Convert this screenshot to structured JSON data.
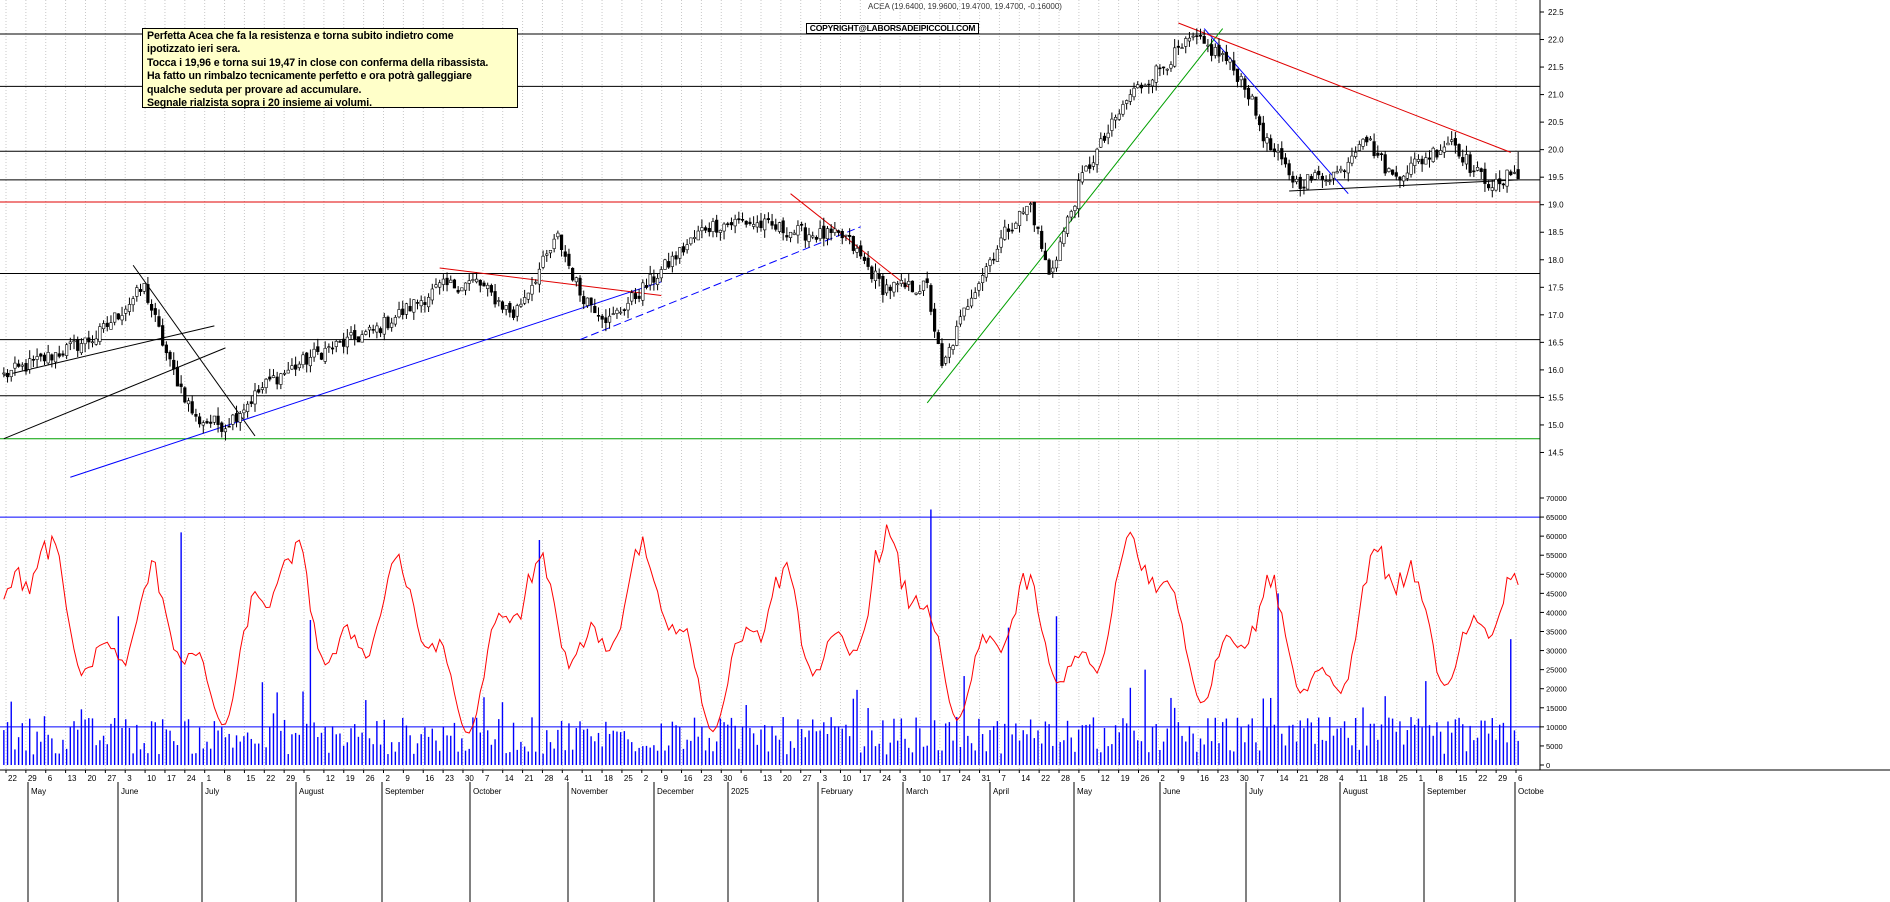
{
  "header": {
    "title": "ACEA (19.6400, 19.9600, 19.4700, 19.4700, -0.16000)",
    "copyright": "COPYRIGHT@LABORSADEIPICCOLI.COM"
  },
  "note": {
    "lines": [
      "Perfetta Acea che fa la resistenza e torna subito indietro come",
      "ipotizzato ieri sera.",
      "Tocca i 19,96 e torna sui 19,47 in close con conferma della ribassista.",
      "Ha fatto un rimbalzo tecnicamente perfetto e ora potrà galleggiare",
      "qualche seduta per provare ad accumulare.",
      "Segnale rialzista sopra i 20 insieme ai volumi."
    ]
  },
  "colors": {
    "candle": "#000000",
    "support_black": "#000000",
    "support_red": "#e00000",
    "support_green": "#00a000",
    "trend_blue": "#0000ff",
    "volume": "#0000ff",
    "oscillator": "#ff0000",
    "grid": "#c8c8c8",
    "note_bg": "#ffffc9"
  },
  "chart_data": [
    {
      "type": "candlestick",
      "title": "",
      "ylim": [
        14.0,
        22.5
      ],
      "y_ticks": [
        "14.5",
        "15.0",
        "15.5",
        "16.0",
        "16.5",
        "17.0",
        "17.5",
        "18.0",
        "18.5",
        "19.0",
        "19.5",
        "20.0",
        "20.5",
        "21.0",
        "21.5",
        "22.0",
        "22.5"
      ],
      "x_day_ticks": [
        "22",
        "29",
        "6",
        "13",
        "20",
        "27",
        "3",
        "10",
        "17",
        "24",
        "1",
        "8",
        "15",
        "22",
        "29",
        "5",
        "12",
        "19",
        "26",
        "2",
        "9",
        "16",
        "23",
        "30",
        "7",
        "14",
        "21",
        "28",
        "4",
        "11",
        "18",
        "25",
        "2",
        "9",
        "16",
        "23",
        "30",
        "6",
        "13",
        "20",
        "27",
        "3",
        "10",
        "17",
        "24",
        "3",
        "10",
        "17",
        "24",
        "31",
        "7",
        "14",
        "22",
        "28",
        "5",
        "12",
        "19",
        "26",
        "2",
        "9",
        "16",
        "23",
        "30",
        "7",
        "14",
        "21",
        "28",
        "4",
        "11",
        "18",
        "25",
        "1",
        "8",
        "15",
        "22",
        "29",
        "6"
      ],
      "x_month_labels": [
        "May",
        "June",
        "July",
        "August",
        "September",
        "October",
        "November",
        "December",
        "2025",
        "February",
        "March",
        "April",
        "May",
        "June",
        "July",
        "August",
        "September",
        "Octobe"
      ],
      "anchors": [
        {
          "bar": 0,
          "close": 15.9
        },
        {
          "bar": 25,
          "close": 16.6
        },
        {
          "bar": 38,
          "close": 17.5
        },
        {
          "bar": 45,
          "close": 16.1
        },
        {
          "bar": 52,
          "close": 15.1
        },
        {
          "bar": 60,
          "close": 15.0
        },
        {
          "bar": 72,
          "close": 15.8
        },
        {
          "bar": 85,
          "close": 16.3
        },
        {
          "bar": 100,
          "close": 16.7
        },
        {
          "bar": 118,
          "close": 17.5
        },
        {
          "bar": 128,
          "close": 17.6
        },
        {
          "bar": 138,
          "close": 17.0
        },
        {
          "bar": 150,
          "close": 18.4
        },
        {
          "bar": 156,
          "close": 17.4
        },
        {
          "bar": 164,
          "close": 16.9
        },
        {
          "bar": 175,
          "close": 17.6
        },
        {
          "bar": 190,
          "close": 18.6
        },
        {
          "bar": 200,
          "close": 18.7
        },
        {
          "bar": 215,
          "close": 18.5
        },
        {
          "bar": 228,
          "close": 18.4
        },
        {
          "bar": 238,
          "close": 17.5
        },
        {
          "bar": 250,
          "close": 17.5
        },
        {
          "bar": 254,
          "close": 16.0
        },
        {
          "bar": 262,
          "close": 17.4
        },
        {
          "bar": 272,
          "close": 18.6
        },
        {
          "bar": 278,
          "close": 19.0
        },
        {
          "bar": 283,
          "close": 17.7
        },
        {
          "bar": 292,
          "close": 19.5
        },
        {
          "bar": 305,
          "close": 21.0
        },
        {
          "bar": 315,
          "close": 21.6
        },
        {
          "bar": 322,
          "close": 22.0
        },
        {
          "bar": 330,
          "close": 21.7
        },
        {
          "bar": 336,
          "close": 21.2
        },
        {
          "bar": 342,
          "close": 20.1
        },
        {
          "bar": 350,
          "close": 19.4
        },
        {
          "bar": 362,
          "close": 19.6
        },
        {
          "bar": 368,
          "close": 20.3
        },
        {
          "bar": 376,
          "close": 19.5
        },
        {
          "bar": 386,
          "close": 19.9
        },
        {
          "bar": 392,
          "close": 20.2
        },
        {
          "bar": 398,
          "close": 19.6
        },
        {
          "bar": 405,
          "close": 19.3
        },
        {
          "bar": 409,
          "close": 19.7
        },
        {
          "bar": 410,
          "close": 19.47
        }
      ],
      "last_bar": {
        "open": 19.64,
        "high": 19.96,
        "low": 19.47,
        "close": 19.47
      },
      "horizontal_levels": [
        {
          "value": 14.75,
          "color": "green"
        },
        {
          "value": 15.53,
          "color": "black"
        },
        {
          "value": 16.55,
          "color": "black"
        },
        {
          "value": 17.75,
          "color": "black"
        },
        {
          "value": 19.05,
          "color": "red"
        },
        {
          "value": 19.45,
          "color": "black"
        },
        {
          "value": 19.97,
          "color": "black"
        },
        {
          "value": 21.15,
          "color": "black"
        },
        {
          "value": 22.1,
          "color": "black"
        }
      ],
      "trendlines": [
        {
          "color": "black",
          "from": {
            "bar": 0,
            "value": 15.9
          },
          "to": {
            "bar": 57,
            "value": 16.8
          }
        },
        {
          "color": "black",
          "from": {
            "bar": 35,
            "value": 17.9
          },
          "to": {
            "bar": 68,
            "value": 14.8
          }
        },
        {
          "color": "black",
          "from": {
            "bar": 0,
            "value": 14.75
          },
          "to": {
            "bar": 60,
            "value": 16.4
          }
        },
        {
          "color": "blue",
          "from": {
            "bar": 18,
            "value": 14.05
          },
          "to": {
            "bar": 178,
            "value": 17.6
          }
        },
        {
          "color": "blue",
          "dashed": true,
          "from": {
            "bar": 156,
            "value": 16.55
          },
          "to": {
            "bar": 232,
            "value": 18.6
          }
        },
        {
          "color": "red",
          "from": {
            "bar": 118,
            "value": 17.85
          },
          "to": {
            "bar": 178,
            "value": 17.35
          }
        },
        {
          "color": "red",
          "from": {
            "bar": 213,
            "value": 19.2
          },
          "to": {
            "bar": 245,
            "value": 17.5
          }
        },
        {
          "color": "green",
          "from": {
            "bar": 250,
            "value": 15.4
          },
          "to": {
            "bar": 330,
            "value": 22.2
          }
        },
        {
          "color": "blue",
          "from": {
            "bar": 325,
            "value": 22.2
          },
          "to": {
            "bar": 364,
            "value": 19.2
          }
        },
        {
          "color": "red",
          "from": {
            "bar": 318,
            "value": 22.3
          },
          "to": {
            "bar": 408,
            "value": 19.95
          }
        },
        {
          "color": "black",
          "from": {
            "bar": 348,
            "value": 19.25
          },
          "to": {
            "bar": 410,
            "value": 19.45
          }
        }
      ]
    },
    {
      "type": "bar",
      "title": "",
      "series": [
        {
          "values_peaks": [
            {
              "bar": 48,
              "value": 61000
            },
            {
              "bar": 31,
              "value": 39000
            },
            {
              "bar": 83,
              "value": 38000
            },
            {
              "bar": 145,
              "value": 59000
            },
            {
              "bar": 251,
              "value": 67000
            },
            {
              "bar": 272,
              "value": 36000
            },
            {
              "bar": 285,
              "value": 39000
            },
            {
              "bar": 309,
              "value": 25000
            },
            {
              "bar": 345,
              "value": 45000
            },
            {
              "bar": 385,
              "value": 22000
            },
            {
              "bar": 408,
              "value": 33000
            }
          ],
          "baseline": 9000
        }
      ],
      "ylim": [
        0,
        70000
      ],
      "y_ticks": [
        "0",
        "5000",
        "10000",
        "15000",
        "20000",
        "25000",
        "30000",
        "35000",
        "40000",
        "45000",
        "50000",
        "55000",
        "60000",
        "65000",
        "70000"
      ],
      "horizontal_levels": [
        10000,
        65000
      ],
      "oscillator_range": [
        8000,
        67000
      ]
    }
  ]
}
